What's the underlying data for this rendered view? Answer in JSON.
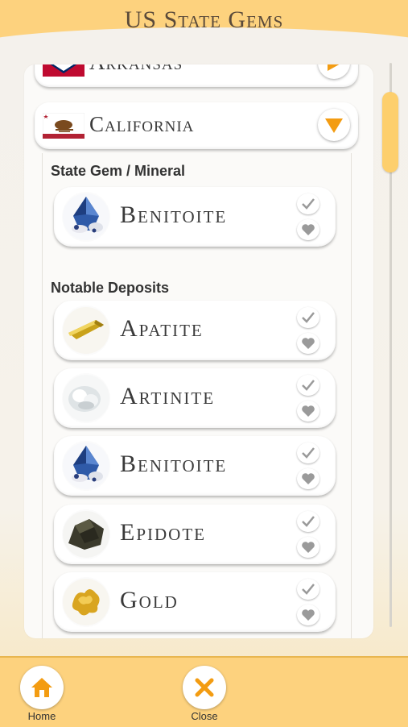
{
  "header": {
    "title": "US State Gems"
  },
  "states": [
    {
      "name": "Arkansas",
      "flag_colors": [
        "#bf0a30",
        "#ffffff",
        "#002868"
      ],
      "expanded": false
    },
    {
      "name": "California",
      "flag_colors": [
        "#ffffff",
        "#b22234",
        "#7a4a1e"
      ],
      "expanded": true,
      "flag_text": "CALIFORNIA REPUBLIC"
    }
  ],
  "sections": {
    "state_gem": "State Gem / Mineral",
    "deposits": "Notable Deposits"
  },
  "state_gems": [
    {
      "name": "Benitoite",
      "image": "benitoite"
    }
  ],
  "deposits": [
    {
      "name": "Apatite",
      "image": "apatite"
    },
    {
      "name": "Artinite",
      "image": "artinite"
    },
    {
      "name": "Benitoite",
      "image": "benitoite"
    },
    {
      "name": "Epidote",
      "image": "epidote"
    },
    {
      "name": "Gold",
      "image": "gold"
    }
  ],
  "icons": {
    "check": "check-icon",
    "heart": "heart-icon",
    "expand": "triangle-down-icon",
    "collapsed": "triangle-right-icon",
    "home": "home-icon",
    "close": "close-icon"
  },
  "colors": {
    "accent": "#f39c12",
    "brand": "#fdd27e",
    "scroll": "#fdcf6d"
  },
  "bottom_nav": {
    "home_label": "Home",
    "close_label": "Close"
  }
}
